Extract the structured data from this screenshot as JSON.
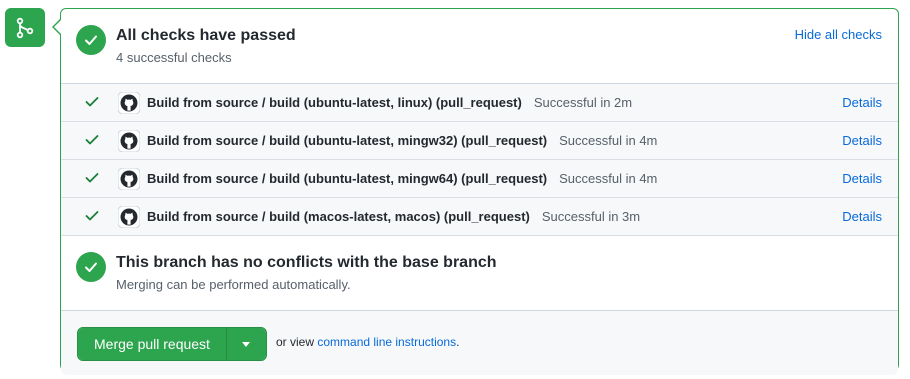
{
  "checks_summary": {
    "title": "All checks have passed",
    "subtitle": "4 successful checks",
    "hide_label": "Hide all checks"
  },
  "checks": [
    {
      "name": "Build from source / build (ubuntu-latest, linux) (pull_request)",
      "status": "Successful in 2m",
      "details": "Details"
    },
    {
      "name": "Build from source / build (ubuntu-latest, mingw32) (pull_request)",
      "status": "Successful in 4m",
      "details": "Details"
    },
    {
      "name": "Build from source / build (ubuntu-latest, mingw64) (pull_request)",
      "status": "Successful in 4m",
      "details": "Details"
    },
    {
      "name": "Build from source / build (macos-latest, macos) (pull_request)",
      "status": "Successful in 3m",
      "details": "Details"
    }
  ],
  "branch": {
    "title": "This branch has no conflicts with the base branch",
    "subtitle": "Merging can be performed automatically."
  },
  "merge": {
    "button_label": "Merge pull request",
    "prefix": "or view",
    "cli_link": "command line instructions",
    "suffix": "."
  },
  "colors": {
    "success": "#2da44e",
    "link": "#0969da",
    "muted": "#57606a"
  },
  "icons": {
    "merge": "git-merge-icon",
    "check": "check-icon",
    "github": "github-icon",
    "caret": "caret-down-icon"
  }
}
